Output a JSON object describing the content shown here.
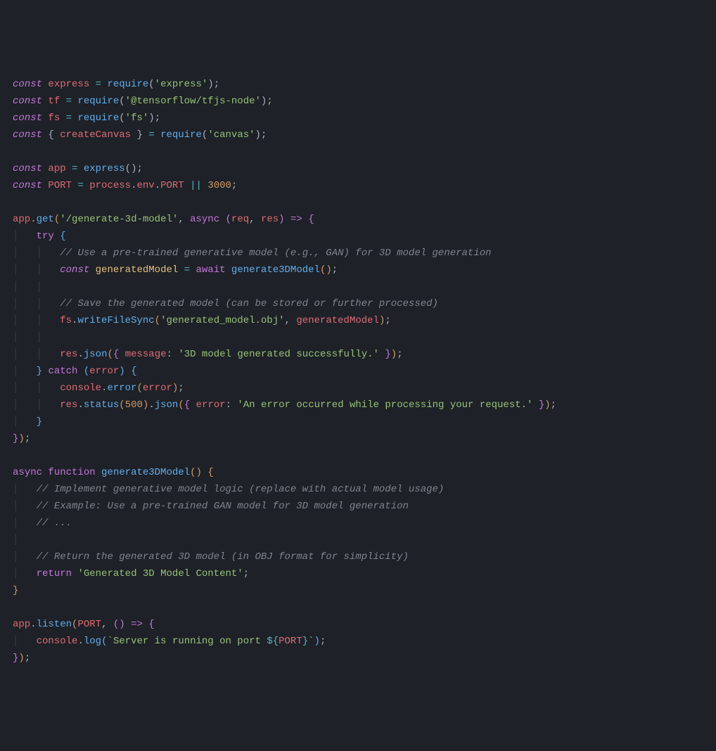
{
  "lines": {
    "l1": {
      "const": "const",
      "sp": " ",
      "express": "express",
      "eq": " = ",
      "require": "require",
      "lp": "(",
      "s": "'express'",
      "rp": ")",
      "semi": ";"
    },
    "l2": {
      "const": "const",
      "sp": " ",
      "tf": "tf",
      "eq": " = ",
      "require": "require",
      "lp": "(",
      "s": "'@tensorflow/tfjs-node'",
      "rp": ")",
      "semi": ";"
    },
    "l3": {
      "const": "const",
      "sp": " ",
      "fs": "fs",
      "eq": " = ",
      "require": "require",
      "lp": "(",
      "s": "'fs'",
      "rp": ")",
      "semi": ";"
    },
    "l4": {
      "const": "const",
      "sp": " ",
      "lb": "{ ",
      "cc": "createCanvas",
      "rb": " }",
      "eq": " = ",
      "require": "require",
      "lp": "(",
      "s": "'canvas'",
      "rp": ")",
      "semi": ";"
    },
    "l6": {
      "const": "const",
      "sp": " ",
      "app": "app",
      "eq": " = ",
      "express": "express",
      "lp": "(",
      "rp": ")",
      "semi": ";"
    },
    "l7": {
      "const": "const",
      "sp": " ",
      "port": "PORT",
      "eq": " = ",
      "process": "process",
      "dot1": ".",
      "env": "env",
      "dot2": ".",
      "portp": "PORT",
      "or": " || ",
      "num": "3000",
      "semi": ";"
    },
    "l9": {
      "app": "app",
      "dot": ".",
      "get": "get",
      "lp": "(",
      "s": "'/generate-3d-model'",
      "comma": ", ",
      "async": "async",
      "sp": " ",
      "lp2": "(",
      "req": "req",
      "c2": ", ",
      "res": "res",
      "rp2": ")",
      "arrow": " => ",
      "lb": "{"
    },
    "l10": {
      "ind": "    ",
      "try": "try",
      "sp": " ",
      "lb": "{"
    },
    "l11": {
      "ind": "        ",
      "c": "// Use a pre-trained generative model (e.g., GAN) for 3D model generation"
    },
    "l12": {
      "ind": "        ",
      "const": "const",
      "sp": " ",
      "gm": "generatedModel",
      "eq": " = ",
      "await": "await",
      "sp2": " ",
      "fn": "generate3DModel",
      "lp": "(",
      "rp": ")",
      "semi": ";"
    },
    "l14": {
      "ind": "        ",
      "c": "// Save the generated model (can be stored or further processed)"
    },
    "l15": {
      "ind": "        ",
      "fs": "fs",
      "dot": ".",
      "wfs": "writeFileSync",
      "lp": "(",
      "s1": "'generated_model.obj'",
      "comma": ", ",
      "gm": "generatedModel",
      "rp": ")",
      "semi": ";"
    },
    "l17": {
      "ind": "        ",
      "res": "res",
      "dot": ".",
      "json": "json",
      "lp": "(",
      "lb": "{ ",
      "msg": "message",
      "col": ": ",
      "s": "'3D model generated successfully.'",
      "rb": " }",
      "rp": ")",
      "semi": ";"
    },
    "l18": {
      "ind": "    ",
      "rb": "}",
      "sp": " ",
      "catch": "catch",
      "sp2": " ",
      "lp": "(",
      "err": "error",
      "rp": ")",
      "sp3": " ",
      "lb": "{"
    },
    "l19": {
      "ind": "        ",
      "console": "console",
      "dot": ".",
      "error": "error",
      "lp": "(",
      "err": "error",
      "rp": ")",
      "semi": ";"
    },
    "l20": {
      "ind": "        ",
      "res": "res",
      "dot": ".",
      "status": "status",
      "lp": "(",
      "num": "500",
      "rp": ")",
      "dot2": ".",
      "json": "json",
      "lp2": "(",
      "lb": "{ ",
      "err": "error",
      "col": ": ",
      "s": "'An error occurred while processing your request.'",
      "rb": " }",
      "rp2": ")",
      "semi": ";"
    },
    "l21": {
      "ind": "    ",
      "rb": "}"
    },
    "l22": {
      "rb": "}",
      "rp": ")",
      "semi": ";"
    },
    "l24": {
      "async": "async",
      "sp": " ",
      "function": "function",
      "sp2": " ",
      "name": "generate3DModel",
      "lp": "(",
      "rp": ")",
      "sp3": " ",
      "lb": "{"
    },
    "l25": {
      "ind": "    ",
      "c": "// Implement generative model logic (replace with actual model usage)"
    },
    "l26": {
      "ind": "    ",
      "c": "// Example: Use a pre-trained GAN model for 3D model generation"
    },
    "l27": {
      "ind": "    ",
      "c": "// ..."
    },
    "l29": {
      "ind": "    ",
      "c": "// Return the generated 3D model (in OBJ format for simplicity)"
    },
    "l30": {
      "ind": "    ",
      "return": "return",
      "sp": " ",
      "s": "'Generated 3D Model Content'",
      "semi": ";"
    },
    "l31": {
      "rb": "}"
    },
    "l33": {
      "app": "app",
      "dot": ".",
      "listen": "listen",
      "lp": "(",
      "port": "PORT",
      "comma": ", ",
      "lp2": "(",
      "rp2": ")",
      "arrow": " => ",
      "lb": "{"
    },
    "l34": {
      "ind": "    ",
      "console": "console",
      "dot": ".",
      "log": "log",
      "lp": "(",
      "bt": "`",
      "s1": "Server is running on port ",
      "dopen": "${",
      "port": "PORT",
      "dclose": "}",
      "bt2": "`",
      "rp": ")",
      "semi": ";"
    },
    "l35": {
      "rb": "}",
      "rp": ")",
      "semi": ";"
    }
  }
}
